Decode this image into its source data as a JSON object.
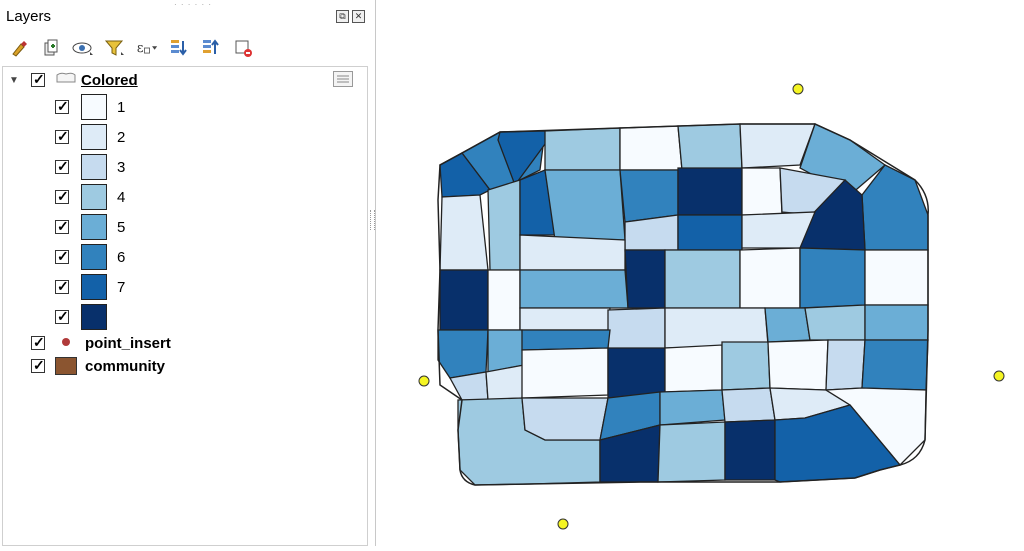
{
  "panel": {
    "title": "Layers",
    "float_btn": "⧉",
    "close_btn": "✕"
  },
  "layers": [
    {
      "name": "Colored",
      "checked": true,
      "expanded": true
    },
    {
      "name": "point_insert",
      "checked": true,
      "symbol_color": "#b03a3a"
    },
    {
      "name": "community",
      "checked": true,
      "symbol_color": "#8b5530"
    }
  ],
  "legend": [
    {
      "label": "1",
      "color": "#f7fbff"
    },
    {
      "label": "2",
      "color": "#deebf7"
    },
    {
      "label": "3",
      "color": "#c6dbef"
    },
    {
      "label": "4",
      "color": "#9ecae1"
    },
    {
      "label": "5",
      "color": "#6baed6"
    },
    {
      "label": "6",
      "color": "#3182bd"
    },
    {
      "label": "7",
      "color": "#1361a8"
    },
    {
      "label": "",
      "color": "#08306b"
    }
  ],
  "toolbar_icons": [
    "style-brush-icon",
    "add-group-icon",
    "eye-visibility-icon",
    "filter-icon",
    "expression-filter-icon",
    "expand-all-icon",
    "collapse-all-icon",
    "remove-layer-icon"
  ],
  "map": {
    "point_color": "#f5f523",
    "outline_color": "#222222"
  }
}
